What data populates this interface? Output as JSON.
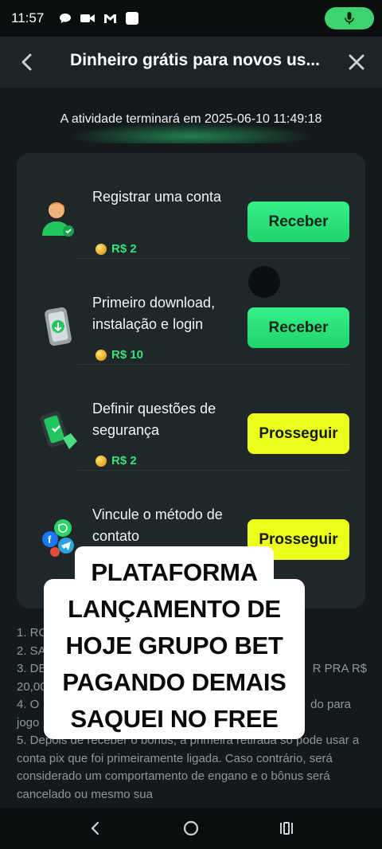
{
  "status_bar": {
    "time": "11:57",
    "icons": [
      "chat-bubble-icon",
      "video-camera-icon",
      "gmail-icon",
      "app-square-icon"
    ],
    "mic_color": "#3ed36f"
  },
  "header": {
    "title": "Dinheiro grátis para novos us..."
  },
  "countdown": "A atividade terminará em 2025-06-10 11:49:18",
  "tasks": [
    {
      "title": "Registrar uma conta",
      "reward": "R$ 2",
      "button": "Receber",
      "button_style": "green",
      "icon": "user-avatar-icon"
    },
    {
      "title": "Primeiro download, instalação e login",
      "reward": "R$ 10",
      "button": "Receber",
      "button_style": "green",
      "icon": "phone-download-icon"
    },
    {
      "title": "Definir questões de segurança",
      "reward": "R$ 2",
      "button": "Prosseguir",
      "button_style": "yellow",
      "icon": "phone-shield-icon"
    },
    {
      "title": "Vincule o método de contato",
      "reward": "",
      "button": "Prosseguir",
      "button_style": "yellow",
      "icon": "social-apps-icon"
    }
  ],
  "rules": {
    "line1": "1. RO",
    "line2": "2. SA",
    "line3a": "3. DE",
    "line3b": "R PRA R$",
    "line3c": "20,00",
    "line4a": "4. O",
    "line4b": "do para",
    "line4c": "jogo",
    "line5": "5. Depois de receber o bônus, a primeira retirada só pode usar a conta pix que foi primeiramente ligada. Caso contrário, será considerado um comportamento de engano e o bônus será cancelado ou mesmo sua"
  },
  "overlay": {
    "lines": [
      "PLATAFORMA",
      "LANÇAMENTO DE",
      "HOJE GRUPO BET",
      "PAGANDO DEMAIS",
      "SAQUEI NO FREE"
    ]
  },
  "colors": {
    "background": "#141a1c",
    "card": "#1f2729",
    "accent_green": "#1fd46c",
    "accent_yellow": "#ecff1a",
    "reward_green": "#39e07a"
  }
}
